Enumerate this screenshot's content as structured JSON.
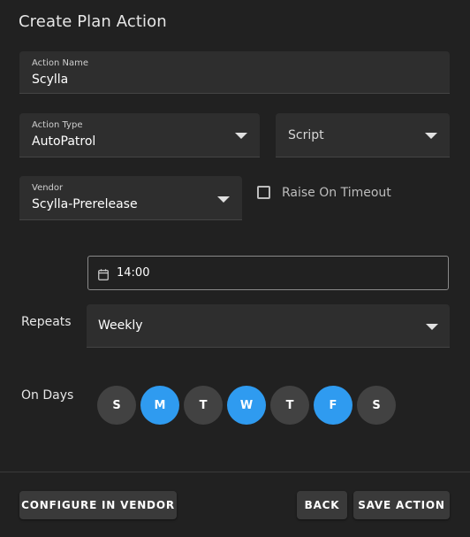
{
  "dialog": {
    "title": "Create Plan Action"
  },
  "action_name": {
    "label": "Action Name",
    "value": "Scylla"
  },
  "action_type": {
    "label": "Action Type",
    "value": "AutoPatrol"
  },
  "script_select": {
    "value": "Script"
  },
  "vendor": {
    "label": "Vendor",
    "value": "Scylla-Prerelease"
  },
  "raise_on_timeout": {
    "label": "Raise On Timeout",
    "checked": false
  },
  "schedule": {
    "time": "14:00",
    "repeats_label": "Repeats",
    "repeats_value": "Weekly",
    "on_days_label": "On Days",
    "days": [
      {
        "letter": "S",
        "selected": false
      },
      {
        "letter": "M",
        "selected": true
      },
      {
        "letter": "T",
        "selected": false
      },
      {
        "letter": "W",
        "selected": true
      },
      {
        "letter": "T",
        "selected": false
      },
      {
        "letter": "F",
        "selected": true
      },
      {
        "letter": "S",
        "selected": false
      }
    ]
  },
  "footer": {
    "configure_label": "CONFIGURE IN VENDOR",
    "back_label": "BACK",
    "save_label": "SAVE ACTION"
  },
  "colors": {
    "background": "#212121",
    "field": "#2e2e2e",
    "accent": "#2f9bf0",
    "day_unselected": "#424242"
  },
  "icons": {
    "calendar": "calendar-icon",
    "dropdown": "caret-down-icon",
    "checkbox": "checkbox-unchecked-icon"
  }
}
